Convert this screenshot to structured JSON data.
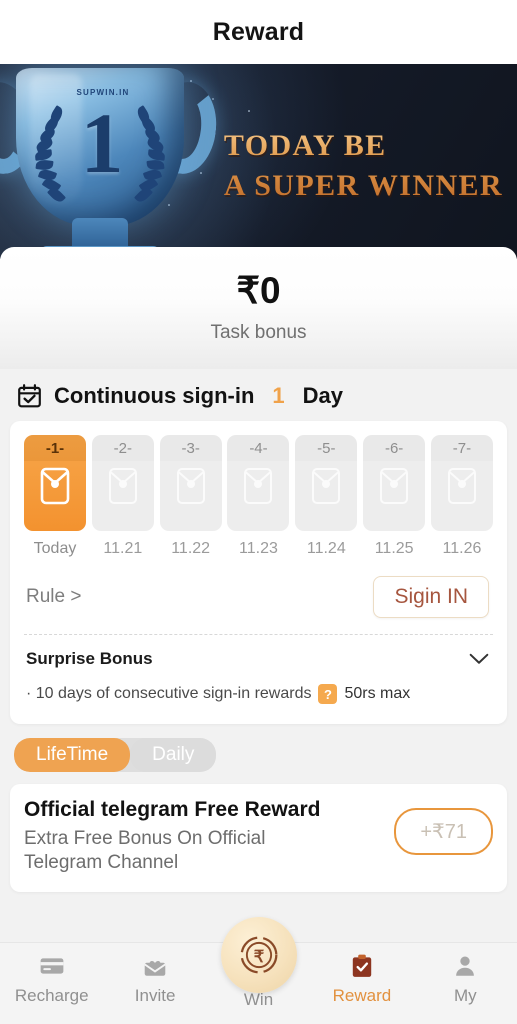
{
  "header": {
    "title": "Reward"
  },
  "banner": {
    "trophy_number": "1",
    "trophy_brand": "SUPWIN.IN",
    "line1": "TODAY BE",
    "line2": "A SUPER WINNER",
    "accent_color": "#e09a4d",
    "background_color": "#161d2b"
  },
  "bonus": {
    "amount": "₹0",
    "label": "Task bonus"
  },
  "signin": {
    "icon": "calendar-check-icon",
    "title": "Continuous sign-in",
    "count": "1",
    "unit": "Day",
    "count_color": "#f0a24a",
    "days": [
      {
        "num": "-1-",
        "date": "Today",
        "active": true
      },
      {
        "num": "-2-",
        "date": "11.21",
        "active": false
      },
      {
        "num": "-3-",
        "date": "11.22",
        "active": false
      },
      {
        "num": "-4-",
        "date": "11.23",
        "active": false
      },
      {
        "num": "-5-",
        "date": "11.24",
        "active": false
      },
      {
        "num": "-6-",
        "date": "11.25",
        "active": false
      },
      {
        "num": "-7-",
        "date": "11.26",
        "active": false
      }
    ],
    "rule_label": "Rule >",
    "signin_button": "Sigin IN",
    "surprise_title": "Surprise Bonus",
    "surprise_chevron": "chevron-down-icon",
    "surprise_desc": "· 10 days of consecutive sign-in rewards",
    "surprise_help_badge": "?",
    "surprise_max": "50rs max"
  },
  "tabs": [
    {
      "label": "LifeTime",
      "active": true
    },
    {
      "label": "Daily",
      "active": false
    }
  ],
  "rewards": [
    {
      "title": "Official telegram Free Reward",
      "subtitle": "Extra Free Bonus On Official Telegram Channel",
      "amount": "+₹71"
    }
  ],
  "bottom_nav": [
    {
      "label": "Recharge",
      "icon": "credit-card-icon",
      "active": false
    },
    {
      "label": "Invite",
      "icon": "invite-envelope-icon",
      "active": false
    },
    {
      "label": "Win",
      "icon": "rupee-coin-icon",
      "active": false
    },
    {
      "label": "Reward",
      "icon": "clipboard-check-icon",
      "active": true
    },
    {
      "label": "My",
      "icon": "person-icon",
      "active": false
    }
  ]
}
